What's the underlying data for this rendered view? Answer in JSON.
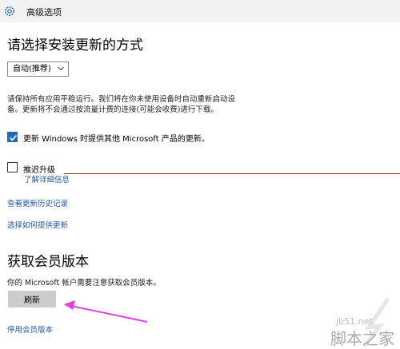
{
  "window": {
    "title": "高级选项"
  },
  "update_method": {
    "heading": "请选择安装更新的方式",
    "select_value": "自动(推荐)",
    "description": "请保持所有应用平稳运行。我们将在你未使用设备时自动重新启动设备。更新将不会通过按流量计费的连接(可能会收费)进行下载。"
  },
  "options": {
    "ms_updates_label": "更新 Windows 时提供其他 Microsoft 产品的更新。",
    "ms_updates_checked": true,
    "defer_label": "推迟升级",
    "defer_checked": false
  },
  "links": {
    "learn_more": "了解详细信息",
    "history": "查看更新历史记录",
    "delivery": "选择如何提供更新"
  },
  "insider": {
    "heading": "获取会员版本",
    "note": "你的 Microsoft 帐户需要注意获取会员版本。",
    "refresh_button": "刷新",
    "stop_link": "停用会员版本"
  },
  "watermark": {
    "site": "jb51.net",
    "name": "脚本之家"
  },
  "colors": {
    "accent": "#1f6bb8",
    "link": "#1f5aa8",
    "annotation_arrow": "#e040e0",
    "annotation_line": "#a7262a"
  }
}
